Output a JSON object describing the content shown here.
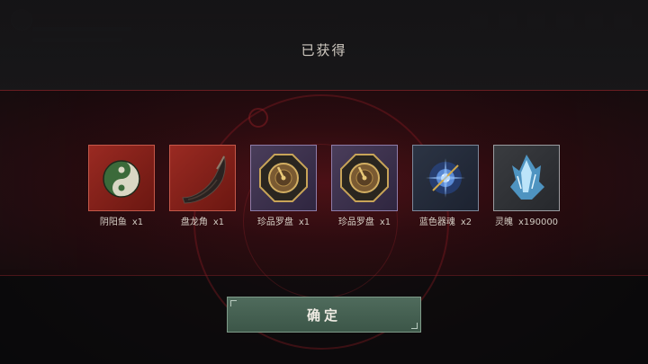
{
  "dialog": {
    "title": "已获得",
    "confirm_label": "确定"
  },
  "rewards": [
    {
      "name": "阴阳鱼",
      "qty": "x1",
      "rarity": "red",
      "icon": "yin-yang-fish-icon"
    },
    {
      "name": "盘龙角",
      "qty": "x1",
      "rarity": "red",
      "icon": "dragon-horn-icon"
    },
    {
      "name": "珍品罗盘",
      "qty": "x1",
      "rarity": "purple",
      "icon": "compass-icon"
    },
    {
      "name": "珍品罗盘",
      "qty": "x1",
      "rarity": "purple",
      "icon": "compass-icon"
    },
    {
      "name": "蓝色器魂",
      "qty": "x2",
      "rarity": "blue",
      "icon": "blue-soul-crystal-icon"
    },
    {
      "name": "灵魄",
      "qty": "x190000",
      "rarity": "gray",
      "icon": "spirit-crystal-icon"
    }
  ],
  "colors": {
    "accent_red": "#8a1c22",
    "confirm_green": "#4f6b5c",
    "title_text": "#cfc9c0"
  }
}
